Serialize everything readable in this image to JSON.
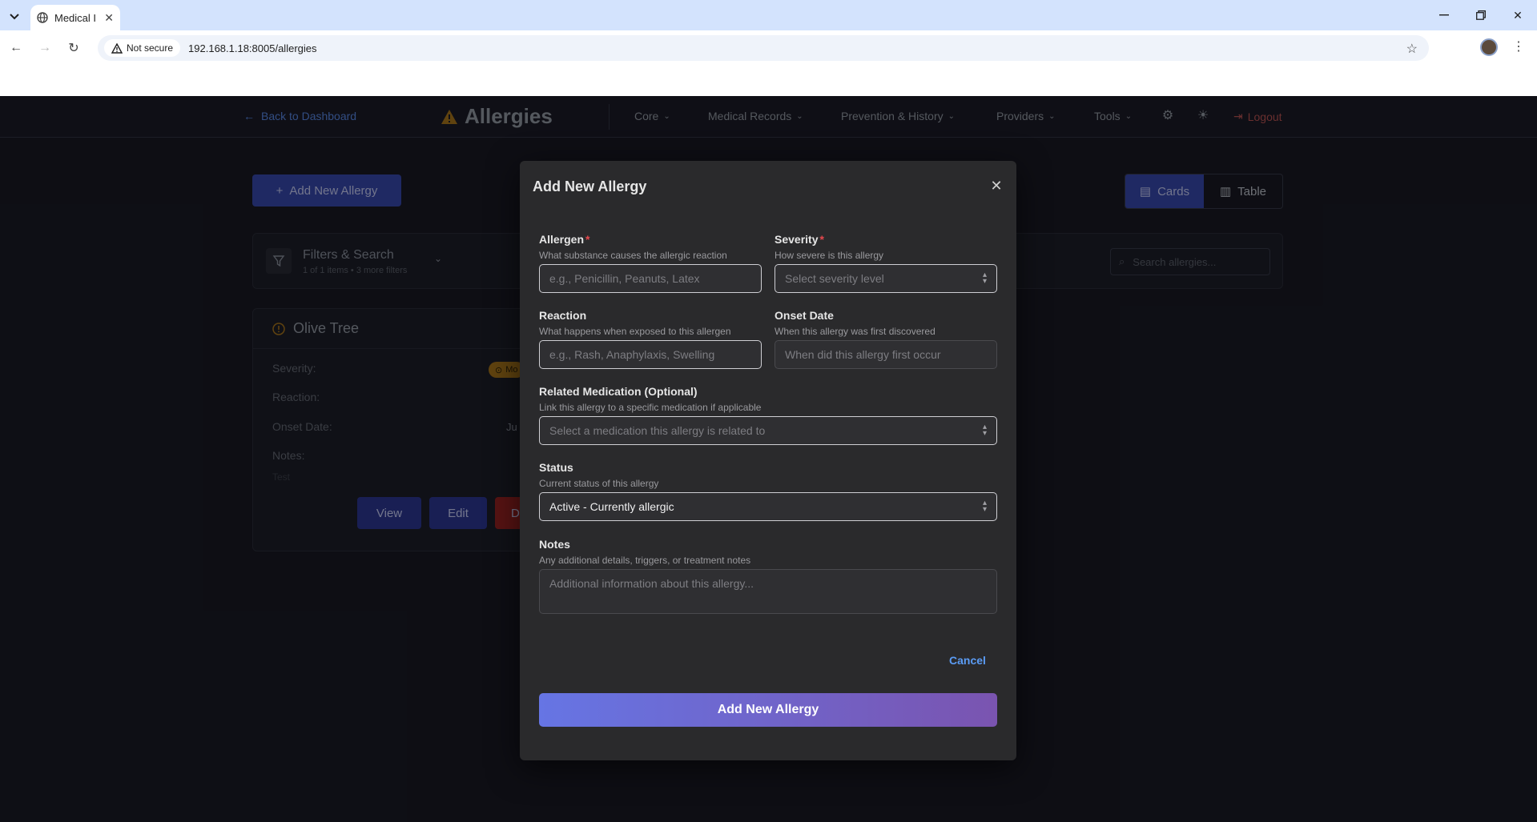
{
  "browser": {
    "tab_title": "Medical I",
    "security_label": "Not secure",
    "url": "192.168.1.18:8005/allergies"
  },
  "header": {
    "back_label": "Back to Dashboard",
    "page_title": "Allergies",
    "nav": [
      "Core",
      "Medical Records",
      "Prevention & History",
      "Providers",
      "Tools"
    ],
    "logout_label": "Logout"
  },
  "page": {
    "add_button_label": "Add New Allergy",
    "view_toggle": {
      "cards_label": "Cards",
      "table_label": "Table",
      "active": "cards"
    },
    "filters": {
      "title": "Filters & Search",
      "subtitle": "1 of 1 items • 3 more filters",
      "search_placeholder": "Search allergies..."
    },
    "card": {
      "name": "Olive Tree",
      "severity_label": "Severity:",
      "severity_badge": "Mo",
      "reaction_label": "Reaction:",
      "onset_label": "Onset Date:",
      "onset_value": "Ju",
      "notes_label": "Notes:",
      "notes_value": "Test",
      "view_label": "View",
      "edit_label": "Edit",
      "delete_label": "D"
    }
  },
  "modal": {
    "title": "Add New Allergy",
    "allergen": {
      "label": "Allergen",
      "required": true,
      "description": "What substance causes the allergic reaction",
      "placeholder": "e.g., Penicillin, Peanuts, Latex"
    },
    "severity": {
      "label": "Severity",
      "required": true,
      "description": "How severe is this allergy",
      "placeholder": "Select severity level"
    },
    "reaction": {
      "label": "Reaction",
      "description": "What happens when exposed to this allergen",
      "placeholder": "e.g., Rash, Anaphylaxis, Swelling"
    },
    "onset_date": {
      "label": "Onset Date",
      "description": "When this allergy was first discovered",
      "placeholder": "When did this allergy first occur"
    },
    "related_medication": {
      "label": "Related Medication (Optional)",
      "description": "Link this allergy to a specific medication if applicable",
      "placeholder": "Select a medication this allergy is related to"
    },
    "status": {
      "label": "Status",
      "description": "Current status of this allergy",
      "value": "Active - Currently allergic"
    },
    "notes": {
      "label": "Notes",
      "description": "Any additional details, triggers, or treatment notes",
      "placeholder": "Additional information about this allergy..."
    },
    "cancel_label": "Cancel",
    "submit_label": "Add New Allergy"
  },
  "colors": {
    "accent": "#5b8def",
    "primary_button": "#3a4bb4",
    "submit_gradient_start": "#6675e4",
    "submit_gradient_end": "#7a54b0",
    "required_marker": "#e5484d",
    "logout": "#c05656"
  }
}
